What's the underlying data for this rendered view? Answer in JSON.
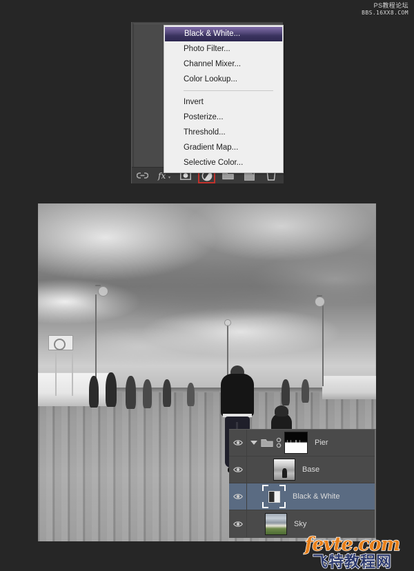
{
  "watermarks": {
    "top_line1": "PS教程论坛",
    "top_line2": "BBS.16XX8.COM",
    "bottom_line1": "fevte.com",
    "bottom_line2": "飞特教程网"
  },
  "adjustment_menu": {
    "items": [
      {
        "label": "Black & White...",
        "selected": true
      },
      {
        "label": "Photo Filter...",
        "selected": false
      },
      {
        "label": "Channel Mixer...",
        "selected": false
      },
      {
        "label": "Color Lookup...",
        "selected": false
      },
      {
        "label": "Invert",
        "selected": false
      },
      {
        "label": "Posterize...",
        "selected": false
      },
      {
        "label": "Threshold...",
        "selected": false
      },
      {
        "label": "Gradient Map...",
        "selected": false
      },
      {
        "label": "Selective Color...",
        "selected": false
      }
    ],
    "separator_after_index": 3,
    "highlight_color": "#564a7c"
  },
  "panel_toolbar": {
    "icons": [
      {
        "name": "link-layers-icon",
        "label": "Link layers",
        "highlighted": false
      },
      {
        "name": "layer-style-fx-icon",
        "label": "Add a layer style",
        "highlighted": false
      },
      {
        "name": "layer-mask-icon",
        "label": "Add layer mask",
        "highlighted": false
      },
      {
        "name": "new-adjustment-layer-icon",
        "label": "Create new fill or adjustment layer",
        "highlighted": true
      },
      {
        "name": "new-group-icon",
        "label": "Create a new group",
        "highlighted": false
      },
      {
        "name": "new-layer-icon",
        "label": "Create a new layer",
        "highlighted": false
      },
      {
        "name": "delete-layer-icon",
        "label": "Delete layer",
        "highlighted": false
      }
    ],
    "highlight_color": "#c1322c"
  },
  "layers_panel": {
    "layers": [
      {
        "name": "Pier",
        "type": "group",
        "visible": true,
        "selected": false,
        "expanded": true,
        "linked": true,
        "thumb": "mask"
      },
      {
        "name": "Base",
        "type": "pixel",
        "visible": true,
        "selected": false,
        "thumb": "photo"
      },
      {
        "name": "Black & White",
        "type": "adjustment",
        "visible": true,
        "selected": true,
        "thumb": "bw-adjustment"
      },
      {
        "name": "Sky",
        "type": "pixel",
        "visible": true,
        "selected": false,
        "thumb": "sky"
      }
    ],
    "selected_row_color": "#5a6b82"
  },
  "canvas": {
    "title": "Pier boardwalk photograph",
    "description": "Black and white photo of a wooden pier boardwalk with dramatic storm clouds, a man walking away from camera with a child, street lamps and pedestrians."
  }
}
